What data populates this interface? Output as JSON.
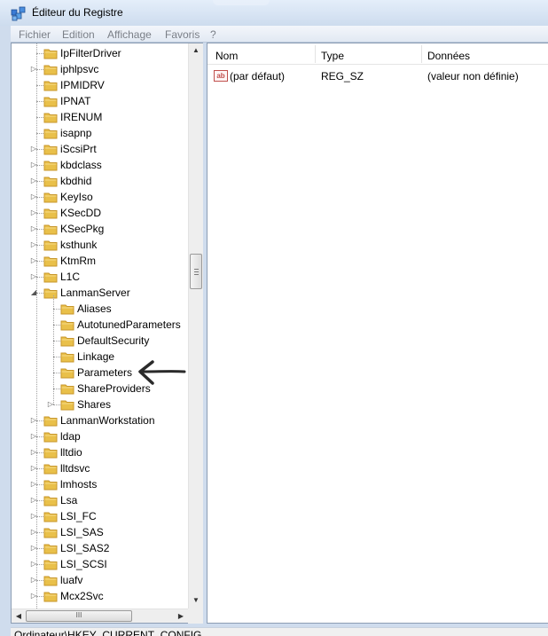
{
  "window": {
    "title": "Éditeur du Registre",
    "icon": "regedit-icon"
  },
  "menu": [
    "Fichier",
    "Edition",
    "Affichage",
    "Favoris",
    "?"
  ],
  "tree": {
    "items": [
      {
        "label": "IpFilterDriver",
        "level": 1,
        "expander": "none"
      },
      {
        "label": "iphlpsvc",
        "level": 1,
        "expander": "collapsed"
      },
      {
        "label": "IPMIDRV",
        "level": 1,
        "expander": "none"
      },
      {
        "label": "IPNAT",
        "level": 1,
        "expander": "none"
      },
      {
        "label": "IRENUM",
        "level": 1,
        "expander": "none"
      },
      {
        "label": "isapnp",
        "level": 1,
        "expander": "none"
      },
      {
        "label": "iScsiPrt",
        "level": 1,
        "expander": "collapsed"
      },
      {
        "label": "kbdclass",
        "level": 1,
        "expander": "collapsed"
      },
      {
        "label": "kbdhid",
        "level": 1,
        "expander": "collapsed"
      },
      {
        "label": "KeyIso",
        "level": 1,
        "expander": "collapsed"
      },
      {
        "label": "KSecDD",
        "level": 1,
        "expander": "collapsed"
      },
      {
        "label": "KSecPkg",
        "level": 1,
        "expander": "collapsed"
      },
      {
        "label": "ksthunk",
        "level": 1,
        "expander": "collapsed"
      },
      {
        "label": "KtmRm",
        "level": 1,
        "expander": "collapsed"
      },
      {
        "label": "L1C",
        "level": 1,
        "expander": "collapsed"
      },
      {
        "label": "LanmanServer",
        "level": 1,
        "expander": "expanded"
      },
      {
        "label": "Aliases",
        "level": 2,
        "expander": "none"
      },
      {
        "label": "AutotunedParameters",
        "level": 2,
        "expander": "none"
      },
      {
        "label": "DefaultSecurity",
        "level": 2,
        "expander": "none"
      },
      {
        "label": "Linkage",
        "level": 2,
        "expander": "none"
      },
      {
        "label": "Parameters",
        "level": 2,
        "expander": "none"
      },
      {
        "label": "ShareProviders",
        "level": 2,
        "expander": "none"
      },
      {
        "label": "Shares",
        "level": 2,
        "expander": "collapsed"
      },
      {
        "label": "LanmanWorkstation",
        "level": 1,
        "expander": "collapsed"
      },
      {
        "label": "ldap",
        "level": 1,
        "expander": "collapsed"
      },
      {
        "label": "lltdio",
        "level": 1,
        "expander": "collapsed"
      },
      {
        "label": "lltdsvc",
        "level": 1,
        "expander": "collapsed"
      },
      {
        "label": "lmhosts",
        "level": 1,
        "expander": "collapsed"
      },
      {
        "label": "Lsa",
        "level": 1,
        "expander": "collapsed"
      },
      {
        "label": "LSI_FC",
        "level": 1,
        "expander": "collapsed"
      },
      {
        "label": "LSI_SAS",
        "level": 1,
        "expander": "collapsed"
      },
      {
        "label": "LSI_SAS2",
        "level": 1,
        "expander": "collapsed"
      },
      {
        "label": "LSI_SCSI",
        "level": 1,
        "expander": "collapsed"
      },
      {
        "label": "luafv",
        "level": 1,
        "expander": "collapsed"
      },
      {
        "label": "Mcx2Svc",
        "level": 1,
        "expander": "collapsed"
      }
    ]
  },
  "list": {
    "columns": [
      "Nom",
      "Type",
      "Données"
    ],
    "rows": [
      {
        "name": "(par défaut)",
        "type": "REG_SZ",
        "data": "(valeur non définie)",
        "icon": "string-value-icon"
      }
    ]
  },
  "status": "Ordinateur\\HKEY_CURRENT_CONFIG",
  "colors": {
    "folder": "#e9c04a",
    "folder_dark": "#c7962a",
    "frame": "#cfdced"
  }
}
